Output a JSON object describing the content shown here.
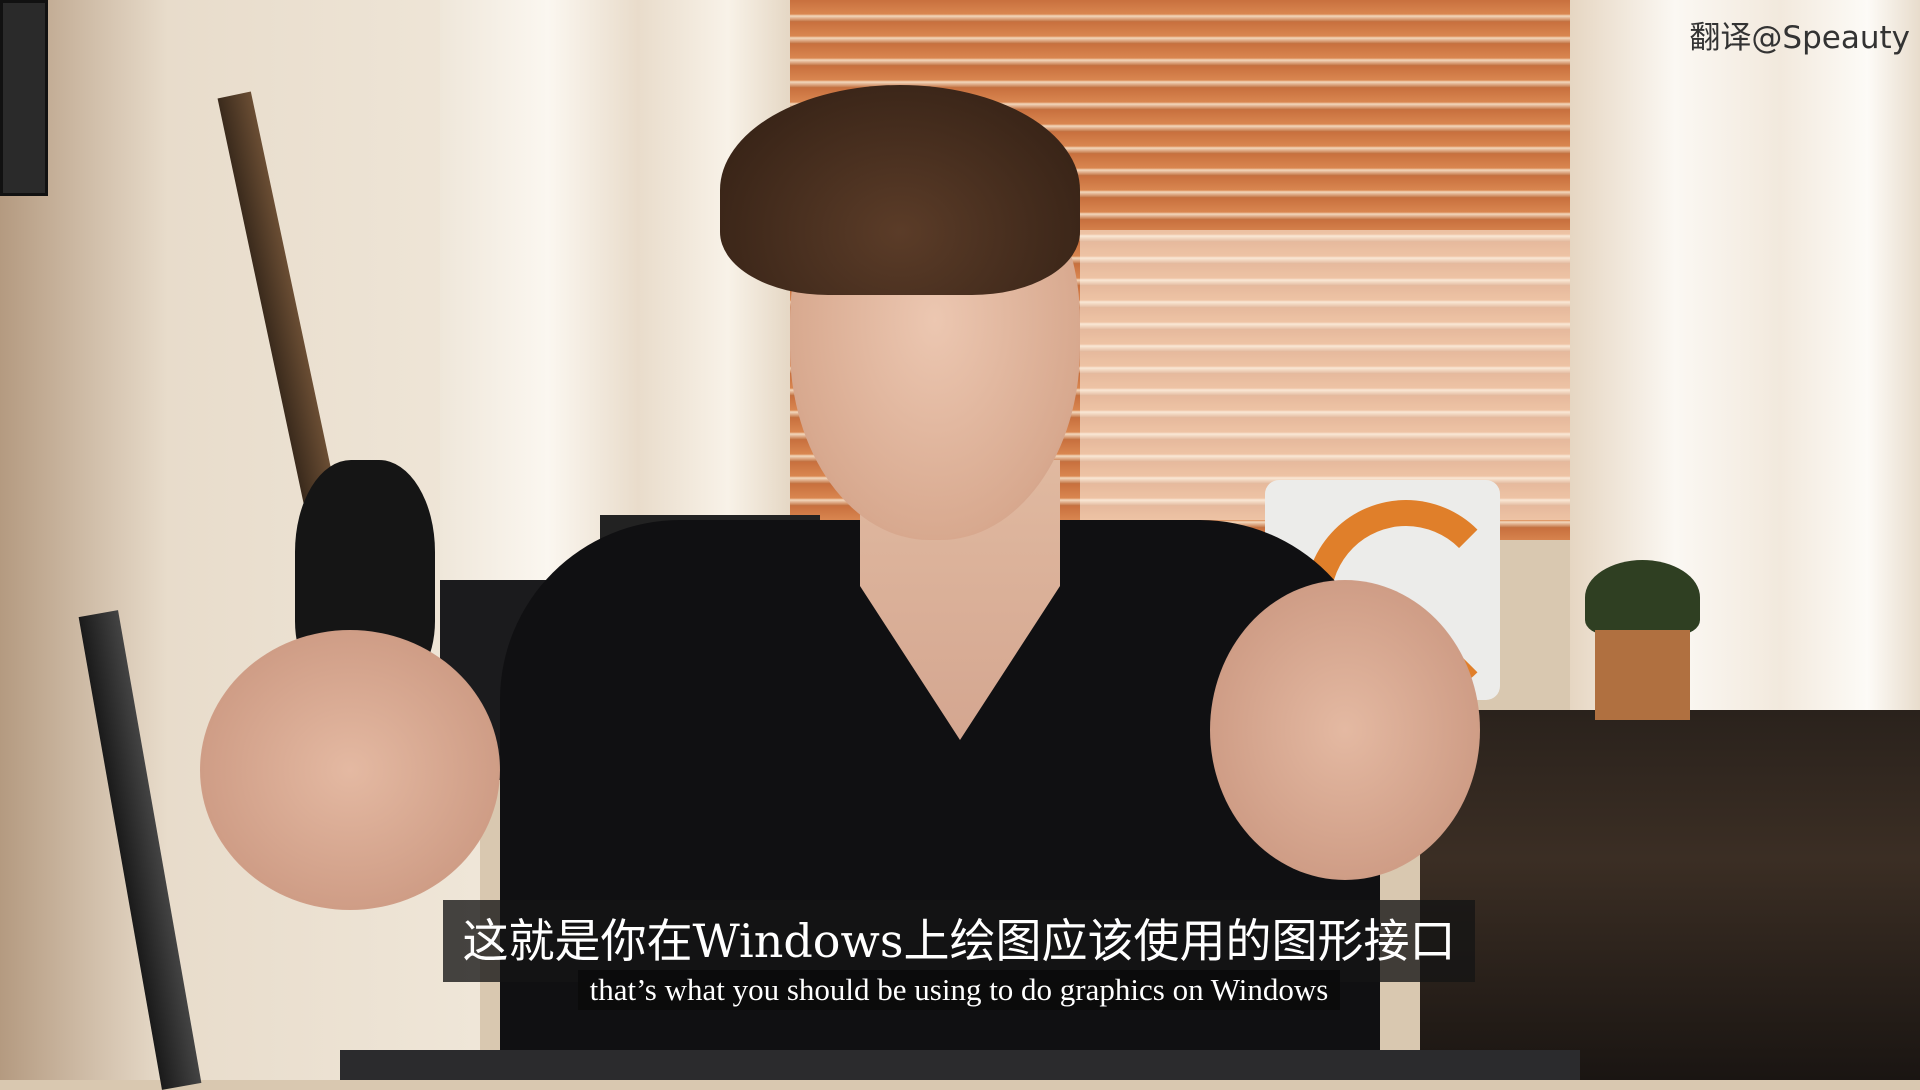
{
  "watermark": "翻译@Speauty",
  "subtitles": {
    "chinese": "这就是你在Windows上绘图应该使用的图形接口",
    "english": "that’s what you should be using to do graphics on Windows"
  }
}
